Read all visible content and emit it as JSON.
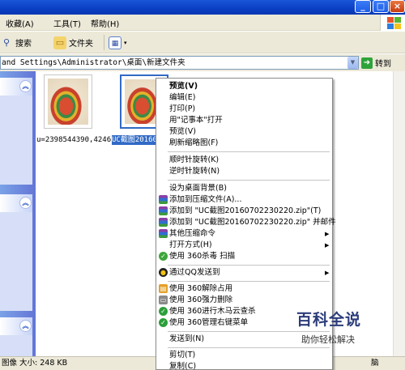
{
  "menubar": {
    "favorites": "收藏(A)",
    "tools": "工具(T)",
    "help": "帮助(H)"
  },
  "toolbar": {
    "search": "搜索",
    "folders": "文件夹"
  },
  "address": {
    "path": "and Settings\\Administrator\\桌面\\新建文件夹",
    "go": "转到"
  },
  "files": [
    {
      "label": "u=2398544390,4246..."
    },
    {
      "label": "UC截图20160"
    }
  ],
  "status": {
    "left": "图像 大小: 248 KB",
    "right": "脑"
  },
  "context_menu": {
    "preview": "预览(V)",
    "edit": "编辑(E)",
    "print": "打印(P)",
    "open_notepad": "用\"记事本\"打开",
    "preview2": "预览(V)",
    "refresh_thumb": "刷新缩略图(F)",
    "rotate_cw": "顺时针旋转(K)",
    "rotate_ccw": "逆时针旋转(N)",
    "set_desktop_bg": "设为桌面背景(B)",
    "add_archive": "添加到压缩文件(A)...",
    "add_zip": "添加到 \"UC截图20160702230220.zip\"(T)",
    "add_zip_email": "添加到 \"UC截图20160702230220.zip\" 并邮件",
    "other_compress": "其他压缩命令",
    "open_with": "打开方式(H)",
    "scan_360": "使用 360杀毒 扫描",
    "send_qq": "通过QQ发送到",
    "unlock_360": "使用 360解除占用",
    "force_delete_360": "使用 360强力删除",
    "trojan_cloud_360": "使用 360进行木马云查杀",
    "manage_menu_360": "使用 360管理右键菜单",
    "send_to": "发送到(N)",
    "cut": "剪切(T)",
    "copy": "复制(C)"
  },
  "watermark": {
    "title": "百科全说",
    "subtitle": "助你轻松解决"
  },
  "colors": {
    "xp_titlebar": "#0a3fc4",
    "selection": "#316ac5",
    "task_pane": "#6375d6"
  },
  "icons": [
    "minimize-icon",
    "maximize-icon",
    "close-icon",
    "search-icon",
    "folder-icon",
    "views-icon",
    "go-arrow-icon",
    "chevron-up-icon",
    "winrar-icon",
    "360-shield-icon",
    "qq-icon"
  ]
}
